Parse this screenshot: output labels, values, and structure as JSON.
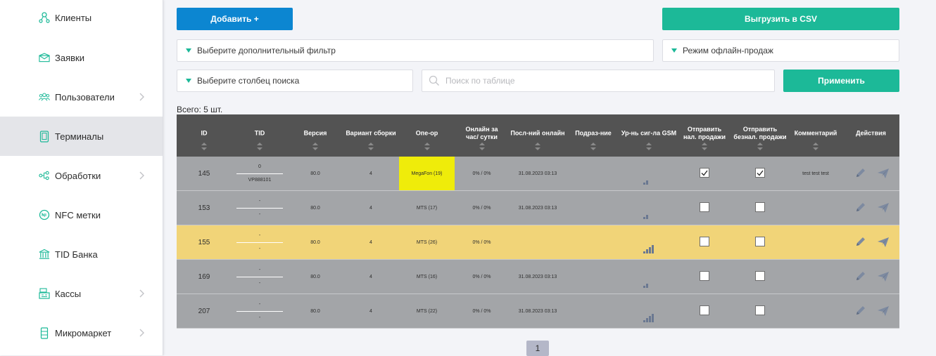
{
  "sidebar": {
    "items": [
      {
        "label": "Клиенты",
        "icon": "clients-icon"
      },
      {
        "label": "Заявки",
        "icon": "envelope-icon"
      },
      {
        "label": "Пользователи",
        "icon": "users-icon"
      },
      {
        "label": "Терминалы",
        "icon": "terminal-icon"
      },
      {
        "label": "Обработки",
        "icon": "processing-icon"
      },
      {
        "label": "NFC метки",
        "icon": "nfc-icon"
      },
      {
        "label": "TID Банка",
        "icon": "bank-icon"
      },
      {
        "label": "Кассы",
        "icon": "cash-register-icon"
      },
      {
        "label": "Микромаркет",
        "icon": "micromarket-icon"
      }
    ],
    "active": "Терминалы"
  },
  "toolbar": {
    "add_label": "Добавить +",
    "export_label": "Выгрузить в CSV",
    "filter_placeholder": "Выберите дополнительный фильтр",
    "mode_select": "Режим офлайн-продаж",
    "column_select": "Выберите столбец поиска",
    "search_placeholder": "Поиск по таблице",
    "apply_label": "Применить"
  },
  "total": "Всего: 5 шт.",
  "table": {
    "columns": [
      "ID",
      "TID",
      "Версия",
      "Вариант сборки",
      "Опе-ор",
      "Онлайн за час/ сутки",
      "Посл-ний онлайн",
      "Подраз-ние",
      "Ур-нь сиг-ла GSM",
      "Отправить нал. продажи",
      "Отправить безнал. продажи",
      "Комментарий",
      "Действия"
    ],
    "rows": [
      {
        "id": "145",
        "tid_top": "0",
        "tid_bottom": "VP888101",
        "version": "80.0",
        "build": "4",
        "operator": "MegaFon (19)",
        "online": "0% / 0%",
        "last_online": "31.08.2023 03:13",
        "subdivision": "",
        "signal": 2,
        "cash": true,
        "cashless": true,
        "comment": "test test test"
      },
      {
        "id": "153",
        "tid_top": "-",
        "tid_bottom": "-",
        "version": "80.0",
        "build": "4",
        "operator": "MTS (17)",
        "online": "0% / 0%",
        "last_online": "31.08.2023 03:13",
        "subdivision": "",
        "signal": 2,
        "cash": false,
        "cashless": false,
        "comment": ""
      },
      {
        "id": "155",
        "tid_top": "-",
        "tid_bottom": "-",
        "version": "80.0",
        "build": "4",
        "operator": "MTS (26)",
        "online": "0% / 0%",
        "last_online": "",
        "subdivision": "",
        "signal": 4,
        "cash": false,
        "cashless": false,
        "comment": ""
      },
      {
        "id": "169",
        "tid_top": "-",
        "tid_bottom": "-",
        "version": "80.0",
        "build": "4",
        "operator": "MTS (16)",
        "online": "0% / 0%",
        "last_online": "31.08.2023 03:13",
        "subdivision": "",
        "signal": 2,
        "cash": false,
        "cashless": false,
        "comment": ""
      },
      {
        "id": "207",
        "tid_top": "-",
        "tid_bottom": "-",
        "version": "80.0",
        "build": "4",
        "operator": "MTS (22)",
        "online": "0% / 0%",
        "last_online": "31.08.2023 03:13",
        "subdivision": "",
        "signal": 4,
        "cash": false,
        "cashless": false,
        "comment": ""
      }
    ]
  },
  "pagination": {
    "current": "1"
  },
  "colors": {
    "accent_blue": "#0c86d1",
    "accent_green": "#1cb998",
    "header_dark": "#535353",
    "row_gray": "#a3a5a8",
    "row_highlight": "#f1d478",
    "operator_highlight": "#efec0a"
  }
}
